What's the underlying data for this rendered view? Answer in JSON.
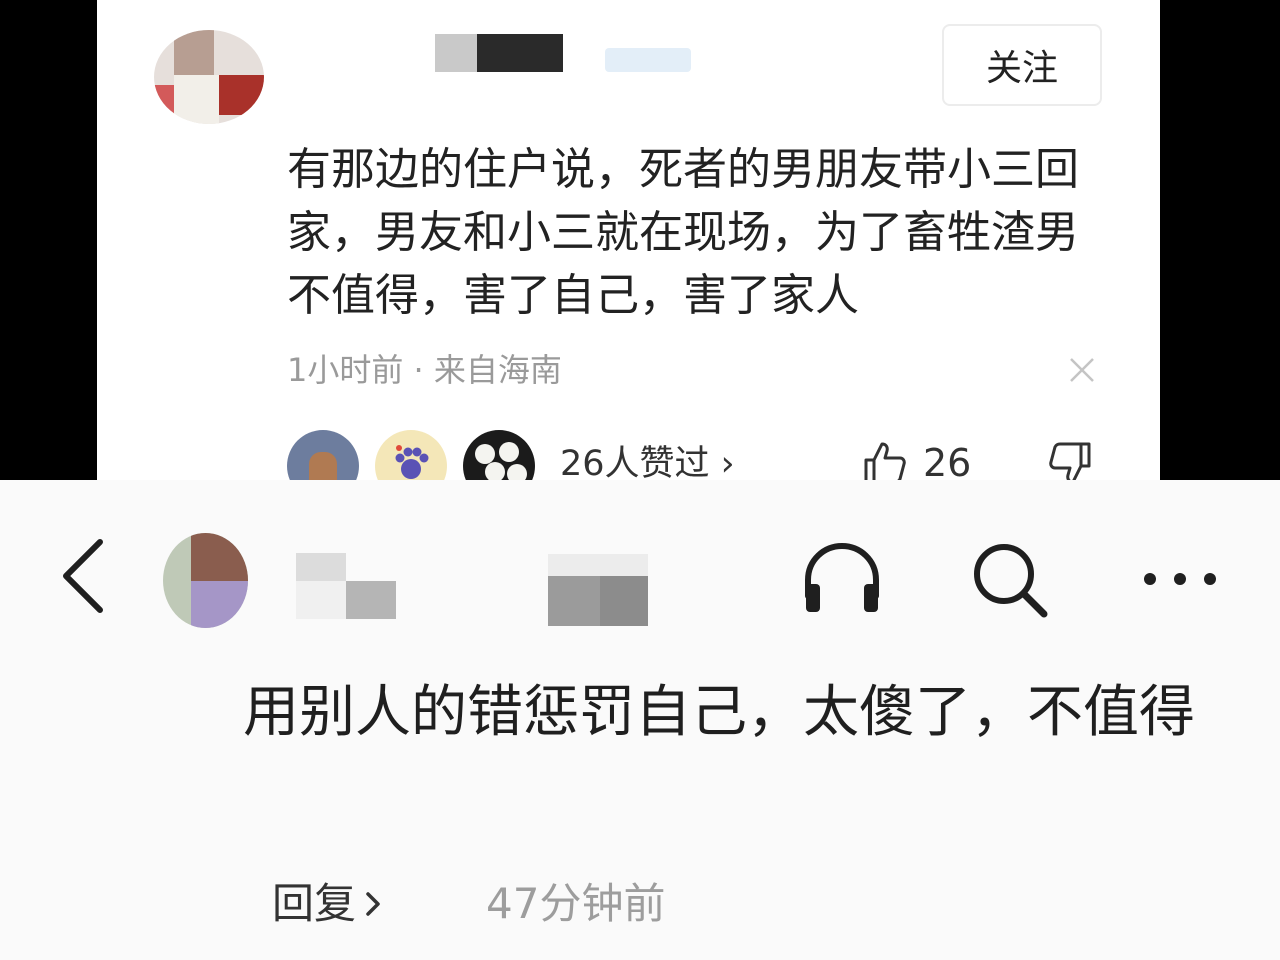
{
  "top_comment": {
    "follow_label": "关注",
    "text": "有那边的住户说，死者的男朋友带小三回家，男友和小三就在现场，为了畜牲渣男不值得，害了自己，害了家人",
    "meta": "1小时前 · 来自海南",
    "likers_label": "26人赞过 ›",
    "like_count": "26",
    "icons": {
      "close": "close-icon",
      "like": "thumbs-up-icon",
      "dislike": "thumbs-down-icon"
    }
  },
  "bottom_comment": {
    "text": "用别人的错惩罚自己，太傻了，不值得",
    "reply_label": "回复",
    "time": "47分钟前",
    "icons": {
      "back": "back-arrow-icon",
      "listen": "headphones-icon",
      "search": "search-icon",
      "more": "more-icon"
    }
  },
  "colors": {
    "text_primary": "#222222",
    "text_secondary": "#9a9a9a",
    "panel_bg_top": "#ffffff",
    "panel_bg_bottom": "#fafafa",
    "frame_bg": "#000000"
  }
}
